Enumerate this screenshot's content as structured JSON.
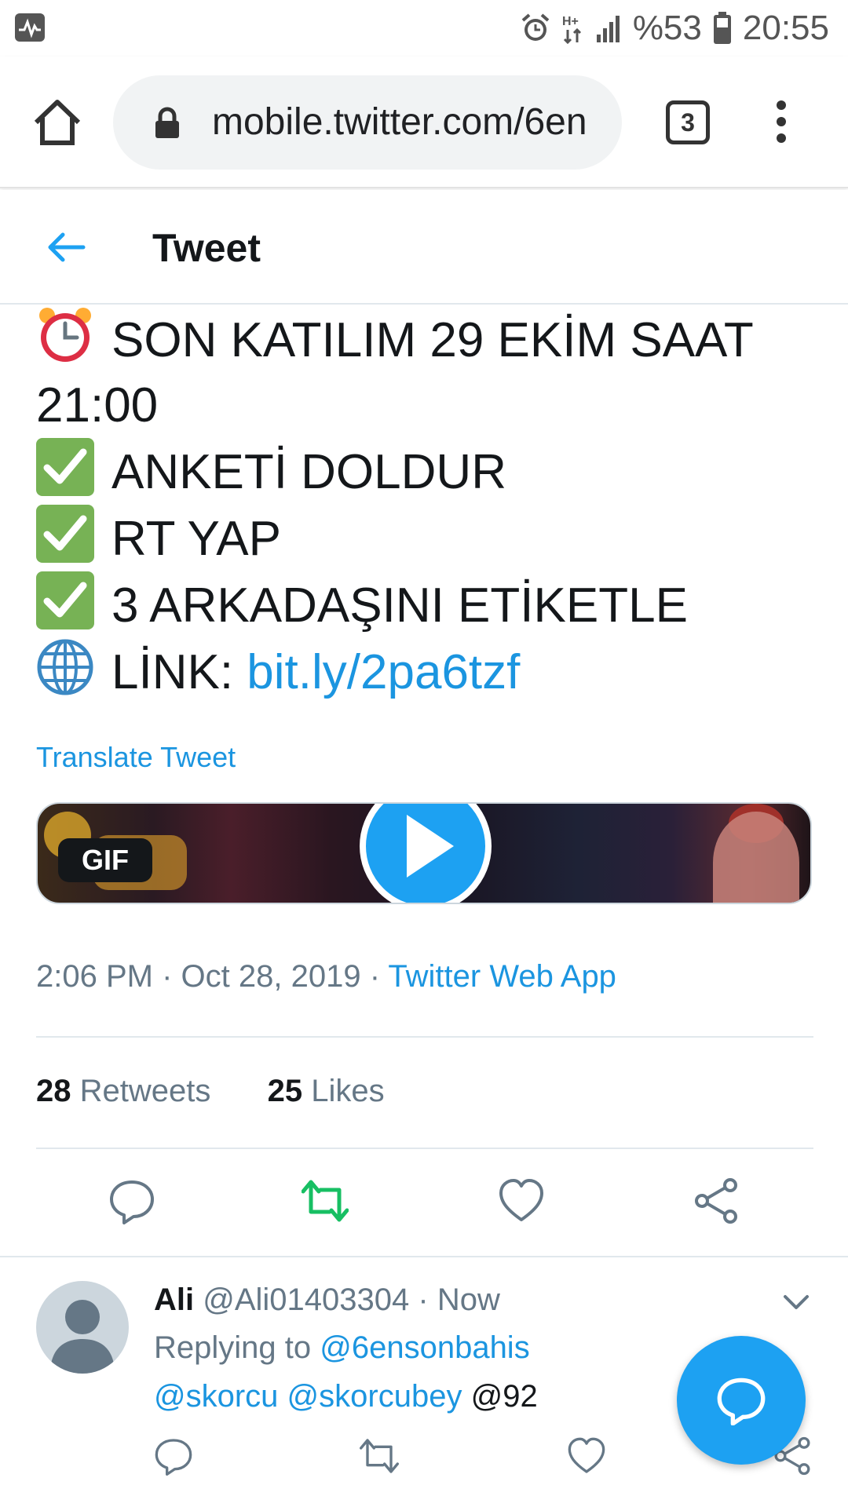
{
  "status_bar": {
    "battery": "%53",
    "time": "20:55",
    "network": "H+"
  },
  "browser": {
    "url": "mobile.twitter.com/6en",
    "tab_count": "3"
  },
  "header": {
    "title": "Tweet"
  },
  "tweet": {
    "lines": [
      {
        "emoji": "alarm-clock",
        "text": "SON KATILIM 29 EKİM SAAT"
      },
      {
        "emoji": "",
        "text": "21:00"
      },
      {
        "emoji": "check",
        "text": "ANKETİ DOLDUR"
      },
      {
        "emoji": "check",
        "text": "RT YAP"
      },
      {
        "emoji": "check",
        "text": "3 ARKADAŞINI ETİKETLE"
      }
    ],
    "link_label": "LİNK: ",
    "link_url": "bit.ly/2pa6tzf",
    "translate": "Translate Tweet",
    "media_badge": "GIF",
    "time": "2:06 PM",
    "date": "Oct 28, 2019",
    "source": "Twitter Web App",
    "retweets_count": "28",
    "retweets_label": "Retweets",
    "likes_count": "25",
    "likes_label": "Likes"
  },
  "reply": {
    "name": "Ali",
    "handle": "@Ali01403304",
    "time": "Now",
    "replying_prefix": "Replying to ",
    "replying_to": "@6ensonbahis",
    "mention1": "@skorcu",
    "mention2": "@skorcubey",
    "mention3": "@92"
  },
  "colors": {
    "accent": "#1da1f2",
    "link": "#1b95e0",
    "retweet_active": "#17bf63"
  },
  "icons": [
    "home-icon",
    "lock-icon",
    "tabs-icon",
    "overflow-menu-icon",
    "back-arrow-icon",
    "reply-icon",
    "retweet-icon",
    "like-icon",
    "share-icon",
    "chevron-down-icon",
    "compose-icon"
  ]
}
